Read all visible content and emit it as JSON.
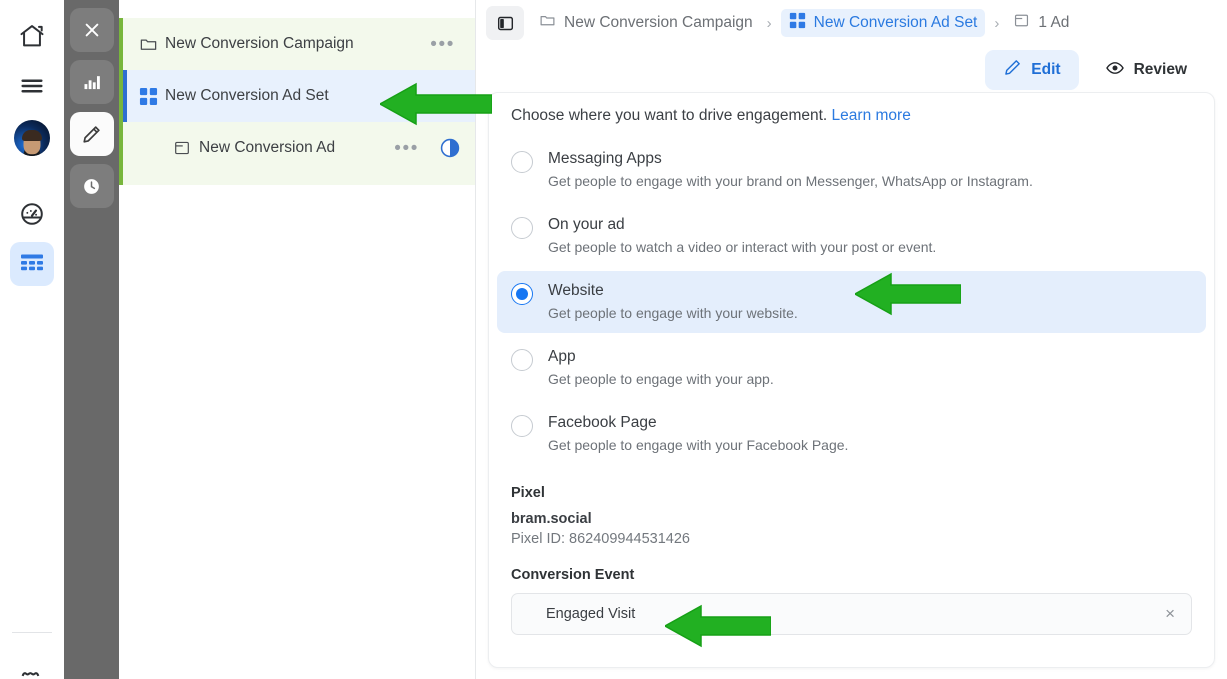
{
  "rail": {
    "items": [
      {
        "name": "home-icon",
        "label": "Home"
      },
      {
        "name": "menu-icon",
        "label": "Menu"
      },
      {
        "name": "avatar",
        "label": "Account"
      },
      {
        "name": "dashboard-icon",
        "label": "Dashboard"
      },
      {
        "name": "table-icon",
        "label": "Table"
      },
      {
        "name": "settings-icon",
        "label": "Settings"
      }
    ]
  },
  "dockbar": {
    "items": [
      {
        "name": "close-icon",
        "label": "Close"
      },
      {
        "name": "bar-chart-icon",
        "label": "Statistics"
      },
      {
        "name": "pencil-icon",
        "label": "Edit"
      },
      {
        "name": "clock-icon",
        "label": "History"
      }
    ]
  },
  "tree": {
    "campaign": {
      "label": "New Conversion Campaign",
      "icon": "folder-icon",
      "menu": "•••"
    },
    "adset": {
      "label": "New Conversion Ad Set",
      "icon": "grid-icon"
    },
    "ad": {
      "label": "New Conversion Ad",
      "icon": "window-icon",
      "menu": "•••",
      "status_icon": "contrast-circle-icon"
    }
  },
  "breadcrumb": {
    "panel_toggle": "panel-toggle-icon",
    "items": [
      {
        "label": "New Conversion Campaign",
        "icon": "folder-icon",
        "current": false
      },
      {
        "label": "New Conversion Ad Set",
        "icon": "grid-icon",
        "current": true
      },
      {
        "label": "1 Ad",
        "icon": "window-icon",
        "current": false
      }
    ],
    "separator": "›"
  },
  "tabs": [
    {
      "label": "Edit",
      "icon": "pencil-icon",
      "active": true
    },
    {
      "label": "Review",
      "icon": "eye-icon",
      "active": false
    }
  ],
  "content": {
    "lead_text": "Choose where you want to drive engagement.",
    "lead_link": "Learn more",
    "options": [
      {
        "title": "Messaging Apps",
        "desc": "Get people to engage with your brand on Messenger, WhatsApp or Instagram.",
        "selected": false
      },
      {
        "title": "On your ad",
        "desc": "Get people to watch a video or interact with your post or event.",
        "selected": false
      },
      {
        "title": "Website",
        "desc": "Get people to engage with your website.",
        "selected": true
      },
      {
        "title": "App",
        "desc": "Get people to engage with your app.",
        "selected": false
      },
      {
        "title": "Facebook Page",
        "desc": "Get people to engage with your Facebook Page.",
        "selected": false
      }
    ],
    "pixel_heading": "Pixel",
    "pixel_name": "bram.social",
    "pixel_id": "Pixel ID: 862409944531426",
    "conversion_heading": "Conversion Event",
    "conversion_value": "Engaged Visit",
    "clear_icon": "×"
  },
  "colors": {
    "accent_blue": "#1877f2",
    "link_blue": "#2b7ae0",
    "annotation_green": "#22b022",
    "campaign_green": "#78b63c",
    "selected_blue_bg": "#e4eefc"
  }
}
